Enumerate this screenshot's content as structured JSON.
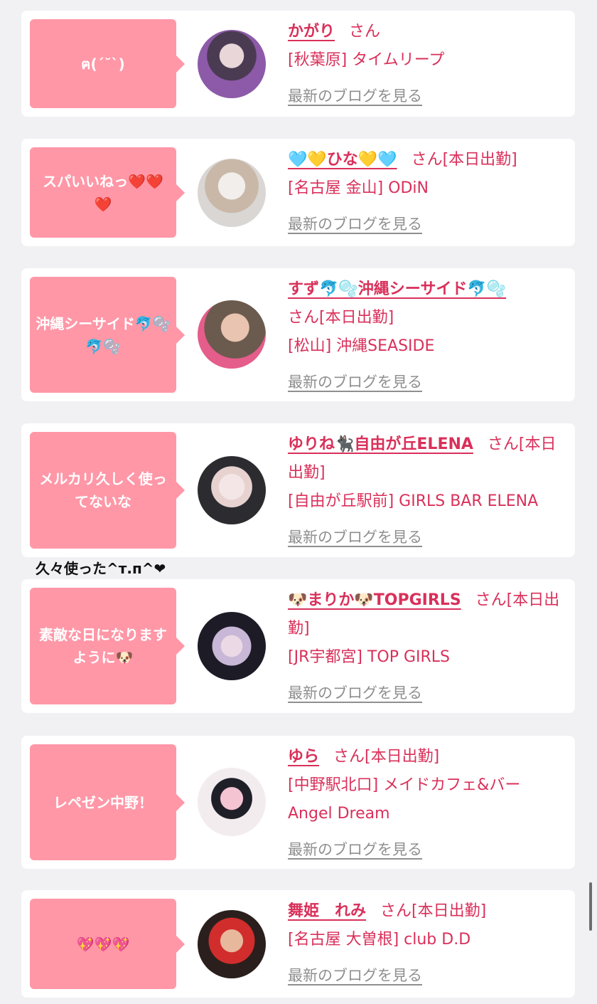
{
  "entries": [
    {
      "bubble": "ฅ(ˊ˘ˋ)",
      "name": "かがり",
      "san": "さん",
      "location": "[秋葉原] タイムリープ",
      "blog": "最新のブログを見る",
      "avatar_colors": [
        "#4a3b52",
        "#8c5aa8",
        "#e9d6d9"
      ]
    },
    {
      "bubble": "スパいいねっ❤️❤️❤️",
      "name": "🩵💛ひな💛🩵",
      "san": "さん[本日出勤]",
      "location": "[名古屋 金山] ODiN",
      "blog": "最新のブログを見る",
      "avatar_colors": [
        "#d9d6d3",
        "#f1eeeb",
        "#c9b8a8"
      ]
    },
    {
      "bubble": "沖縄シーサイド🐬🫧🐬🫧",
      "name": "すず🐬🫧沖縄シーサイド🐬🫧",
      "san": "さん[本日出勤]",
      "location": "[松山] 沖縄SEASIDE",
      "blog": "最新のブログを見る",
      "avatar_colors": [
        "#6b5a4e",
        "#e9c4b0",
        "#e55d8a"
      ]
    },
    {
      "bubble": "メルカリ久しく使ってないな",
      "name": "ゆりね🐈‍⬛自由が丘ELENA",
      "san": "さん[本日出勤]",
      "location": "[自由が丘駅前] GIRLS BAR ELENA",
      "blog": "最新のブログを見る",
      "avatar_colors": [
        "#2b2b30",
        "#e7d2d0",
        "#f4e6e6"
      ]
    },
    {
      "bubble": "素敵な日になりますように🐶",
      "name": "🐶まりか🐶TOPGIRLS",
      "san": "さん[本日出勤]",
      "location": "[JR宇都宮] TOP GIRLS",
      "blog": "最新のブログを見る",
      "avatar_colors": [
        "#1d1b26",
        "#c8b7d6",
        "#ebd9e5"
      ]
    },
    {
      "bubble": "レペゼン中野！",
      "name": "ゆら",
      "san": "さん[本日出勤]",
      "location": "[中野駅北口] メイドカフェ&バー Angel Dream",
      "blog": "最新のブログを見る",
      "avatar_colors": [
        "#f2ecef",
        "#1f1f28",
        "#f5c4d3"
      ]
    },
    {
      "bubble": "💖💖💖",
      "name": "舞姫　れみ",
      "san": "さん[本日出勤]",
      "location": "[名古屋 大曽根] club D.D",
      "blog": "最新のブログを見る",
      "avatar_colors": [
        "#2a1f1c",
        "#e8b89c",
        "#d12d2d"
      ]
    }
  ],
  "caption": "久々使った^т.п^❤"
}
